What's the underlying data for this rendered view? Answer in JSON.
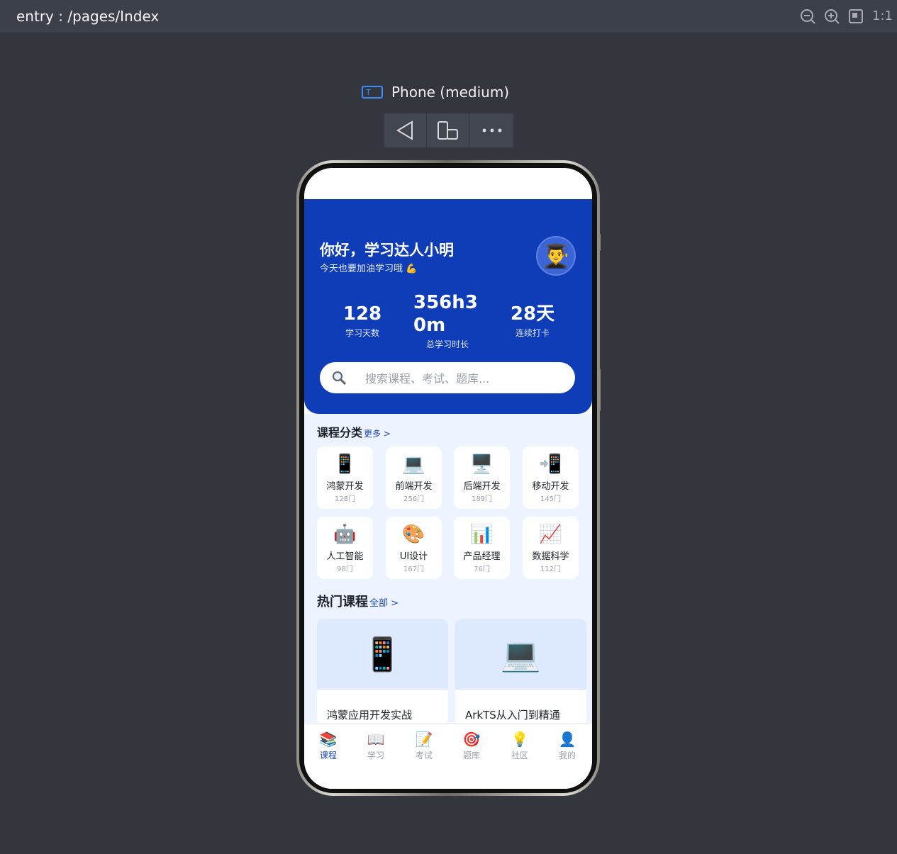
{
  "previewer": {
    "route": "entry : /pages/Index",
    "zoom_label": "1:1",
    "device_name": "Phone (medium)"
  },
  "app": {
    "header": {
      "greeting": "你好，学习达人小明",
      "subtitle": "今天也要加油学习哦 💪",
      "avatar": "👨‍🎓"
    },
    "stats": [
      {
        "value": "128",
        "label": "学习天数"
      },
      {
        "value": "356h30m",
        "label": "总学习时长"
      },
      {
        "value": "28天",
        "label": "连续打卡"
      }
    ],
    "search": {
      "placeholder": "搜索课程、考试、题库..."
    },
    "categories_section": {
      "title": "课程分类",
      "more": "更多 >"
    },
    "categories": [
      {
        "icon": "📱",
        "name": "鸿蒙开发",
        "count": "128门"
      },
      {
        "icon": "💻",
        "name": "前端开发",
        "count": "256门"
      },
      {
        "icon": "🖥️",
        "name": "后端开发",
        "count": "189门"
      },
      {
        "icon": "📲",
        "name": "移动开发",
        "count": "145门"
      },
      {
        "icon": "🤖",
        "name": "人工智能",
        "count": "98门"
      },
      {
        "icon": "🎨",
        "name": "UI设计",
        "count": "167门"
      },
      {
        "icon": "📊",
        "name": "产品经理",
        "count": "76门"
      },
      {
        "icon": "📈",
        "name": "数据科学",
        "count": "112门"
      }
    ],
    "hot_section": {
      "title": "热门课程",
      "more": "全部 >"
    },
    "courses": [
      {
        "icon": "📱",
        "title": "鸿蒙应用开发实战"
      },
      {
        "icon": "💻",
        "title": "ArkTS从入门到精通"
      }
    ],
    "tabs": [
      {
        "icon": "📚",
        "label": "课程",
        "active": true
      },
      {
        "icon": "📖",
        "label": "学习",
        "active": false
      },
      {
        "icon": "📝",
        "label": "考试",
        "active": false
      },
      {
        "icon": "🎯",
        "label": "题库",
        "active": false
      },
      {
        "icon": "💡",
        "label": "社区",
        "active": false
      },
      {
        "icon": "👤",
        "label": "我的",
        "active": false
      }
    ]
  }
}
